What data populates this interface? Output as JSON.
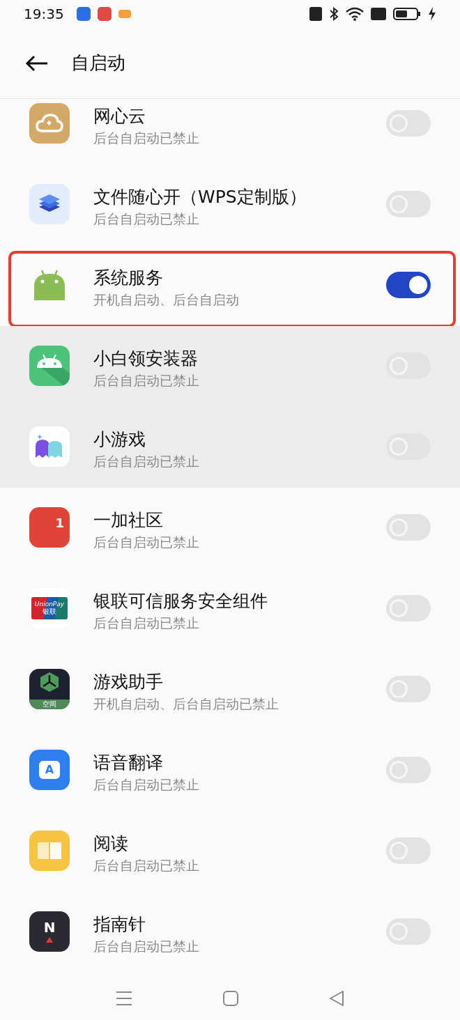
{
  "status_bar": {
    "time": "19:35"
  },
  "header": {
    "title": "自启动"
  },
  "apps": [
    {
      "kind": "cloud",
      "name": "网心云",
      "status": "后台自启动已禁止",
      "on": false,
      "highlighted": false,
      "outlined": false
    },
    {
      "kind": "layers",
      "name": "文件随心开（WPS定制版）",
      "status": "后台自启动已禁止",
      "on": false,
      "highlighted": false,
      "outlined": false
    },
    {
      "kind": "android",
      "name": "系统服务",
      "status": "开机自启动、后台自启动",
      "on": true,
      "highlighted": false,
      "outlined": true
    },
    {
      "kind": "android-grid",
      "name": "小白领安装器",
      "status": "后台自启动已禁止",
      "on": false,
      "highlighted": true,
      "outlined": false
    },
    {
      "kind": "ghosts",
      "name": "小游戏",
      "status": "后台自启动已禁止",
      "on": false,
      "highlighted": true,
      "outlined": false
    },
    {
      "kind": "community",
      "name": "一加社区",
      "status": "后台自启动已禁止",
      "on": false,
      "highlighted": false,
      "outlined": false,
      "icon_text": [
        "1"
      ]
    },
    {
      "kind": "unionpay",
      "name": "银联可信服务安全组件",
      "status": "后台自启动已禁止",
      "on": false,
      "highlighted": false,
      "outlined": false,
      "icon_text": [
        "UnionPay",
        "银联"
      ]
    },
    {
      "kind": "game",
      "name": "游戏助手",
      "status": "开机自启动、后台自启动已禁止",
      "on": false,
      "highlighted": false,
      "outlined": false,
      "icon_text": [
        "空间"
      ]
    },
    {
      "kind": "translate",
      "name": "语音翻译",
      "status": "后台自启动已禁止",
      "on": false,
      "highlighted": false,
      "outlined": false,
      "icon_text": [
        "A"
      ]
    },
    {
      "kind": "book",
      "name": "阅读",
      "status": "后台自启动已禁止",
      "on": false,
      "highlighted": false,
      "outlined": false
    },
    {
      "kind": "compass",
      "name": "指南针",
      "status": "后台自启动已禁止",
      "on": false,
      "highlighted": false,
      "outlined": false,
      "icon_text": [
        "N"
      ]
    }
  ]
}
